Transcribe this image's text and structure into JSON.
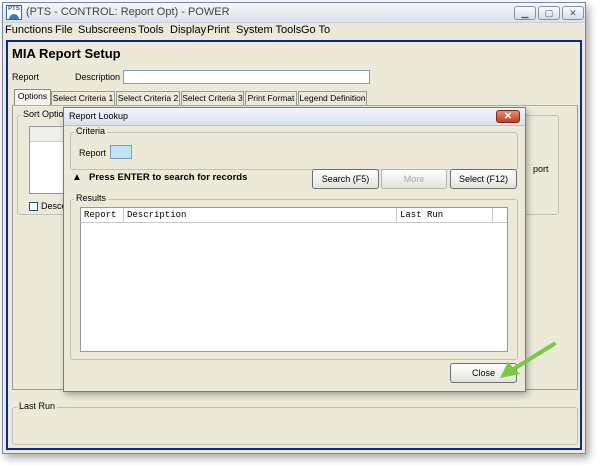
{
  "window": {
    "title": "(PTS - CONTROL: Report Opt) - POWER",
    "icon_text": "PTS",
    "controls": [
      "minimize-icon",
      "maximize-icon",
      "close-icon"
    ]
  },
  "menubar": {
    "items": [
      {
        "label": "Functions"
      },
      {
        "label": "File"
      },
      {
        "label": "Subscreens"
      },
      {
        "label": "Tools"
      },
      {
        "label": "Display"
      },
      {
        "label": "Print"
      },
      {
        "label": "System Tools"
      },
      {
        "label": "Go To"
      }
    ]
  },
  "form": {
    "title": "MIA Report Setup",
    "report_label": "Report",
    "description_label": "Description",
    "description_value": "",
    "tabs": [
      {
        "label": "Options"
      },
      {
        "label": "Select Criteria 1"
      },
      {
        "label": "Select Criteria 2"
      },
      {
        "label": "Select Criteria 3"
      },
      {
        "label": "Print Format"
      },
      {
        "label": "Legend Definition"
      }
    ],
    "sort_options_label": "Sort Option",
    "descending_label": "Descen",
    "right_partial_label": "port",
    "last_run_label": "Last Run"
  },
  "dialog": {
    "title": "Report Lookup",
    "close_glyph": "✕",
    "criteria_label": "Criteria",
    "report_label": "Report",
    "report_value": "",
    "hint": "Press ENTER to search for records",
    "hint_glyph": "▲",
    "search_button": "Search (F5)",
    "more_button": "More",
    "select_button": "Select (F12)",
    "results_label": "Results",
    "columns": [
      "Report",
      "Description",
      "Last Run"
    ],
    "rows": [],
    "close_button": "Close"
  },
  "colors": {
    "window_bg": "#ece9d8",
    "frame_border": "#0a2a8a",
    "input_highlight": "#bfe3f7",
    "annotation_arrow": "#7ac943"
  }
}
